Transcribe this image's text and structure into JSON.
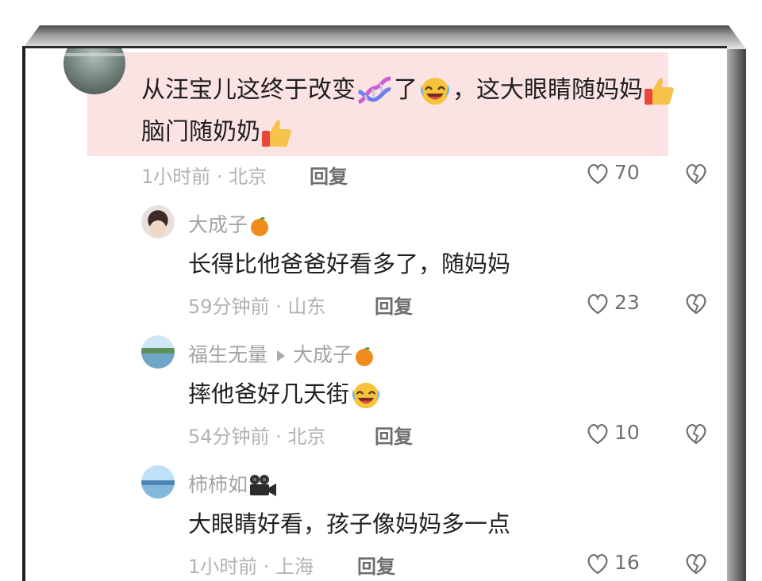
{
  "main_comment": {
    "line1": "从汪宝儿这终于改变",
    "line1b": "了",
    "line1c": "，这大眼睛随妈妈",
    "line2": "脑门随奶奶",
    "time_location": "1小时前 · 北京",
    "reply_label": "回复",
    "likes": "70"
  },
  "replies": [
    {
      "user": "大成子",
      "text": "长得比他爸爸好看多了，随妈妈",
      "time_location": "59分钟前 · 山东",
      "reply_label": "回复",
      "likes": "23"
    },
    {
      "user": "福生无量",
      "reply_to": "大成子",
      "text": "摔他爸好几天街",
      "time_location": "54分钟前 · 北京",
      "reply_label": "回复",
      "likes": "10"
    },
    {
      "user": "柿柿如",
      "text": "大眼睛好看，孩子像妈妈多一点",
      "time_location": "1小时前 · 上海",
      "reply_label": "回复",
      "likes": "16"
    }
  ],
  "colors": {
    "highlight": "#fbe3e4",
    "secondary_text": "#b2b2b2",
    "reply_button": "#6e6e6e"
  },
  "icons": [
    "heart-icon",
    "dislike-icon",
    "thumbs-up-emoji",
    "laughing-emoji",
    "dna-emoji",
    "orange-emoji",
    "camera-emoji"
  ]
}
